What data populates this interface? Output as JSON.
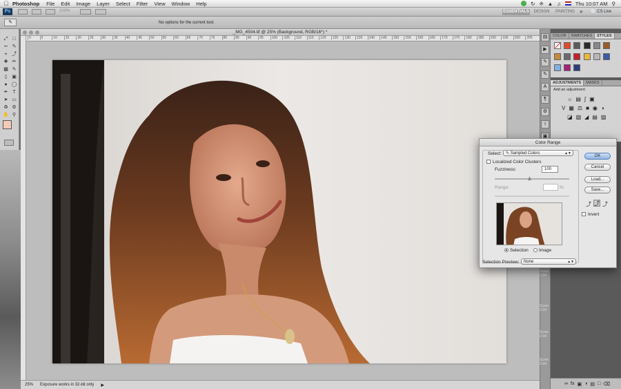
{
  "menubar": {
    "app_name": "Photoshop",
    "items": [
      "File",
      "Edit",
      "Image",
      "Layer",
      "Select",
      "Filter",
      "View",
      "Window",
      "Help"
    ],
    "clock": "Thu 10:07 AM",
    "cs_live": "CS Live"
  },
  "appbar": {
    "logo": "Ps",
    "zoom": "100%",
    "workspaces": [
      "ESSENTIALS",
      "DESIGN",
      "PAINTING"
    ]
  },
  "options": {
    "message": "No options for the current tool."
  },
  "document": {
    "title": "_MG_4504.tif @ 25% (Background, RGB/16*) *",
    "zoom": "25%",
    "status": "Exposure works in 32-bit only",
    "ruler_ticks": [
      "0",
      "5",
      "10",
      "15",
      "20",
      "25",
      "30",
      "35",
      "40",
      "45",
      "50",
      "55",
      "60",
      "65",
      "70",
      "75",
      "80",
      "85",
      "90",
      "95",
      "100",
      "105",
      "110",
      "115",
      "120",
      "125",
      "130",
      "135",
      "140",
      "145",
      "150",
      "155",
      "160",
      "165",
      "170",
      "175",
      "180",
      "185",
      "190",
      "195",
      "200",
      "205"
    ]
  },
  "panels": {
    "color_tabs": [
      "COLOR",
      "SWATCHES",
      "STYLES"
    ],
    "adjust_tabs": [
      "ADJUSTMENTS",
      "MASKS"
    ],
    "adjust_hint": "Add an adjustment"
  },
  "dialog": {
    "title": "Color Range",
    "select_label": "Select:",
    "select_value": "Sampled Colors",
    "localized_label": "Localized Color Clusters",
    "fuzziness_label": "Fuzziness:",
    "fuzziness_value": "100",
    "range_label": "Range:",
    "range_unit": "%",
    "selection_label": "Selection",
    "image_label": "Image",
    "preview_label": "Selection Preview:",
    "preview_value": "None",
    "ok": "OK",
    "cancel": "Cancel",
    "load": "Load...",
    "save": "Save...",
    "invert": "Invert"
  },
  "desktop": {
    "items": [
      "Scree",
      "2-04",
      "Scree",
      "2-04",
      "Scree",
      "2-04",
      "Scree",
      "2-04"
    ]
  }
}
